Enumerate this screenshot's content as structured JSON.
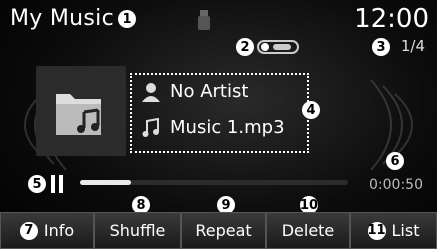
{
  "header": {
    "title": "My Music",
    "clock": "12:00",
    "track_count": "1/4"
  },
  "callouts": {
    "c1": "1",
    "c2": "2",
    "c3": "3",
    "c4": "4",
    "c5": "5",
    "c6": "6",
    "c7": "7",
    "c8": "8",
    "c9": "9",
    "c10": "10",
    "c11": "11"
  },
  "track": {
    "artist": "No Artist",
    "filename": "Music 1.mp3",
    "elapsed": "0:00:50",
    "progress_fraction": 0.19
  },
  "buttons": {
    "info": "Info",
    "shuffle": "Shuffle",
    "repeat": "Repeat",
    "delete": "Delete",
    "list": "List"
  },
  "colors": {
    "background": "#000000",
    "text": "#ffffff",
    "button": "#2a2a2a"
  },
  "icons": [
    "usb-icon",
    "repeat-mode-icon",
    "music-folder-icon",
    "artist-icon",
    "music-note-icon",
    "play-pause-icon"
  ]
}
